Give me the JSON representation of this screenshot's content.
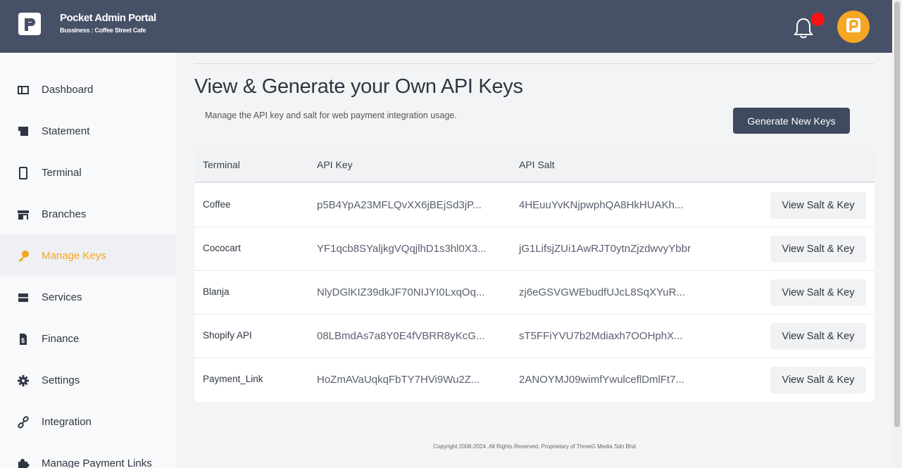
{
  "header": {
    "title": "Pocket Admin Portal",
    "subtitle": "Bussiness : Coffee Street Cafe",
    "notification_icon": "bell-icon",
    "notification_badge_color": "#ff1010",
    "avatar_color": "#f5a623",
    "bar_color": "#465167"
  },
  "sidebar": {
    "items": [
      {
        "label": "Dashboard",
        "icon": "dashboard-icon",
        "active": false
      },
      {
        "label": "Statement",
        "icon": "statement-icon",
        "active": false
      },
      {
        "label": "Terminal",
        "icon": "terminal-icon",
        "active": false
      },
      {
        "label": "Branches",
        "icon": "store-icon",
        "active": false
      },
      {
        "label": "Manage Keys",
        "icon": "key-icon",
        "active": true
      },
      {
        "label": "Services",
        "icon": "services-icon",
        "active": false
      },
      {
        "label": "Finance",
        "icon": "finance-icon",
        "active": false
      },
      {
        "label": "Settings",
        "icon": "gear-icon",
        "active": false
      },
      {
        "label": "Integration",
        "icon": "link-icon",
        "active": false
      },
      {
        "label": "Manage Payment Links",
        "icon": "puzzle-icon",
        "active": false
      }
    ],
    "accent_color": "#f5a623"
  },
  "main": {
    "title": "View & Generate your Own API Keys",
    "subtitle": "Manage the API key and salt for web payment integration usage.",
    "generate_button": "Generate New Keys",
    "table": {
      "columns": [
        "Terminal",
        "API Key",
        "API Salt"
      ],
      "rows": [
        {
          "terminal": "Coffee",
          "api_key": "p5B4YpA23MFLQvXX6jBEjSd3jP...",
          "api_salt": "4HEuuYvKNjpwphQA8HkHUAKh...",
          "action": "View Salt & Key"
        },
        {
          "terminal": "Cococart",
          "api_key": "YF1qcb8SYaljkgVQqjlhD1s3hl0X3...",
          "api_salt": "jG1LifsjZUi1AwRJT0ytnZjzdwvyYbbr",
          "action": "View Salt & Key"
        },
        {
          "terminal": "Blanja",
          "api_key": "NlyDGlKIZ39dkJF70NIJYI0LxqOq...",
          "api_salt": "zj6eGSVGWEbudfUJcL8SqXYuR...",
          "action": "View Salt & Key"
        },
        {
          "terminal": "Shopify API",
          "api_key": "08LBmdAs7a8Y0E4fVBRR8yKcG...",
          "api_salt": "sT5FFiYVU7b2Mdiaxh7OOHphX...",
          "action": "View Salt & Key"
        },
        {
          "terminal": "Payment_Link",
          "api_key": "HoZmAVaUqkqFbTY7HVi9Wu2Z...",
          "api_salt": "2ANOYMJ09wimfYwulceflDmlFt7...",
          "action": "View Salt & Key"
        }
      ]
    }
  },
  "footer": {
    "copyright": "Copyright 2008-2024. All Rights Reserved. Proprietary of ThreeG Media Sdn Bhd"
  }
}
